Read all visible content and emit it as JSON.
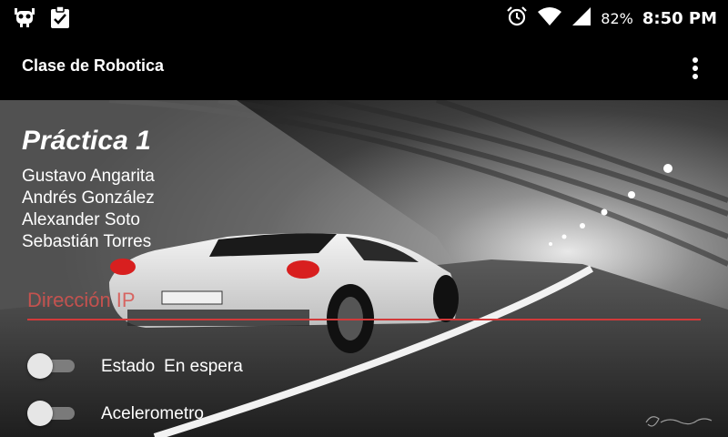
{
  "status_bar": {
    "battery_percent": "82%",
    "time": "8:50 PM",
    "icons": [
      "cyanogen-bug-icon",
      "clipboard-check-icon",
      "alarm-icon",
      "wifi-icon",
      "signal-icon"
    ]
  },
  "app_bar": {
    "title": "Clase de Robotica",
    "menu_icon": "more-vert-icon"
  },
  "main": {
    "heading": "Práctica 1",
    "authors": [
      "Gustavo Angarita",
      "Andrés González",
      "Alexander Soto",
      "Sebastián Torres"
    ],
    "ip_field": {
      "placeholder": "Dirección IP",
      "value": ""
    },
    "estado": {
      "label": "Estado",
      "value": "En espera",
      "switch_on": false
    },
    "acelerometro": {
      "label": "Acelerometro",
      "switch_on": false
    }
  },
  "colors": {
    "accent": "#d23a3a",
    "app_bar_bg": "#000000"
  }
}
